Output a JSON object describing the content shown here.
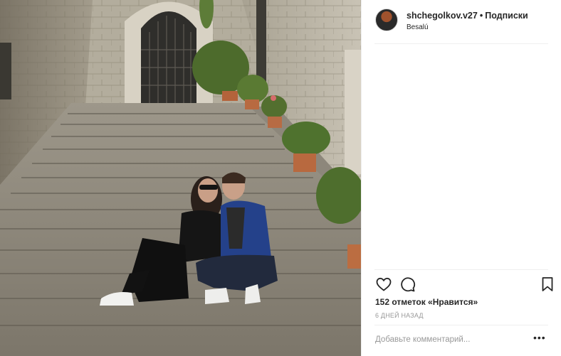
{
  "post": {
    "username": "shchegolkov.v27",
    "separator": "•",
    "follow_label": "Подписки",
    "location": "Besalú",
    "likes_text": "152 отметок «Нравится»",
    "timestamp": "6 ДНЕЙ НАЗАД",
    "comment_placeholder": "Добавьте комментарий...",
    "more_label": "•••",
    "photo_description_icons": [
      "like-icon",
      "comment-icon",
      "bookmark-icon"
    ]
  },
  "colors": {
    "text_primary": "#262626",
    "text_secondary": "#999999",
    "divider": "#efefef"
  }
}
